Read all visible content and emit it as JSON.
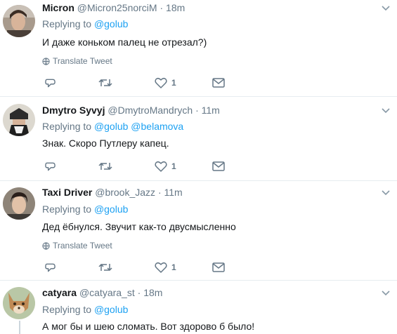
{
  "tweets": [
    {
      "name": "Micron",
      "handle": "@Micron25norciM",
      "time": "18m",
      "replying_prefix": "Replying to",
      "replying_to": [
        "@golub"
      ],
      "text": "И даже коньком палец не отрезал?)",
      "translate": "Translate Tweet",
      "likes": "1"
    },
    {
      "name": "Dmytro Syvyj",
      "handle": "@DmytroMandrych",
      "time": "11m",
      "replying_prefix": "Replying to",
      "replying_to": [
        "@golub",
        "@belamova"
      ],
      "text": "Знак. Скоро Путлеру капец.",
      "likes": "1"
    },
    {
      "name": "Taxi Driver",
      "handle": "@brook_Jazz",
      "time": "11m",
      "replying_prefix": "Replying to",
      "replying_to": [
        "@golub"
      ],
      "text": "Дед ёбнулся. Звучит как-то двусмысленно",
      "translate": "Translate Tweet",
      "likes": "1"
    },
    {
      "name": "catyara",
      "handle": "@catyara_st",
      "time": "18m",
      "replying_prefix": "Replying to",
      "replying_to": [
        "@golub"
      ],
      "text": "А мог бы и шею сломать. Вот здорово б было!"
    }
  ],
  "separator": "·",
  "colors": {
    "link": "#1da1f2",
    "muted": "#657786",
    "border": "#e6ecf0",
    "text": "#14171a"
  },
  "icons": [
    "reply-icon",
    "retweet-icon",
    "like-icon",
    "message-icon",
    "globe-icon",
    "chevron-down-icon"
  ]
}
